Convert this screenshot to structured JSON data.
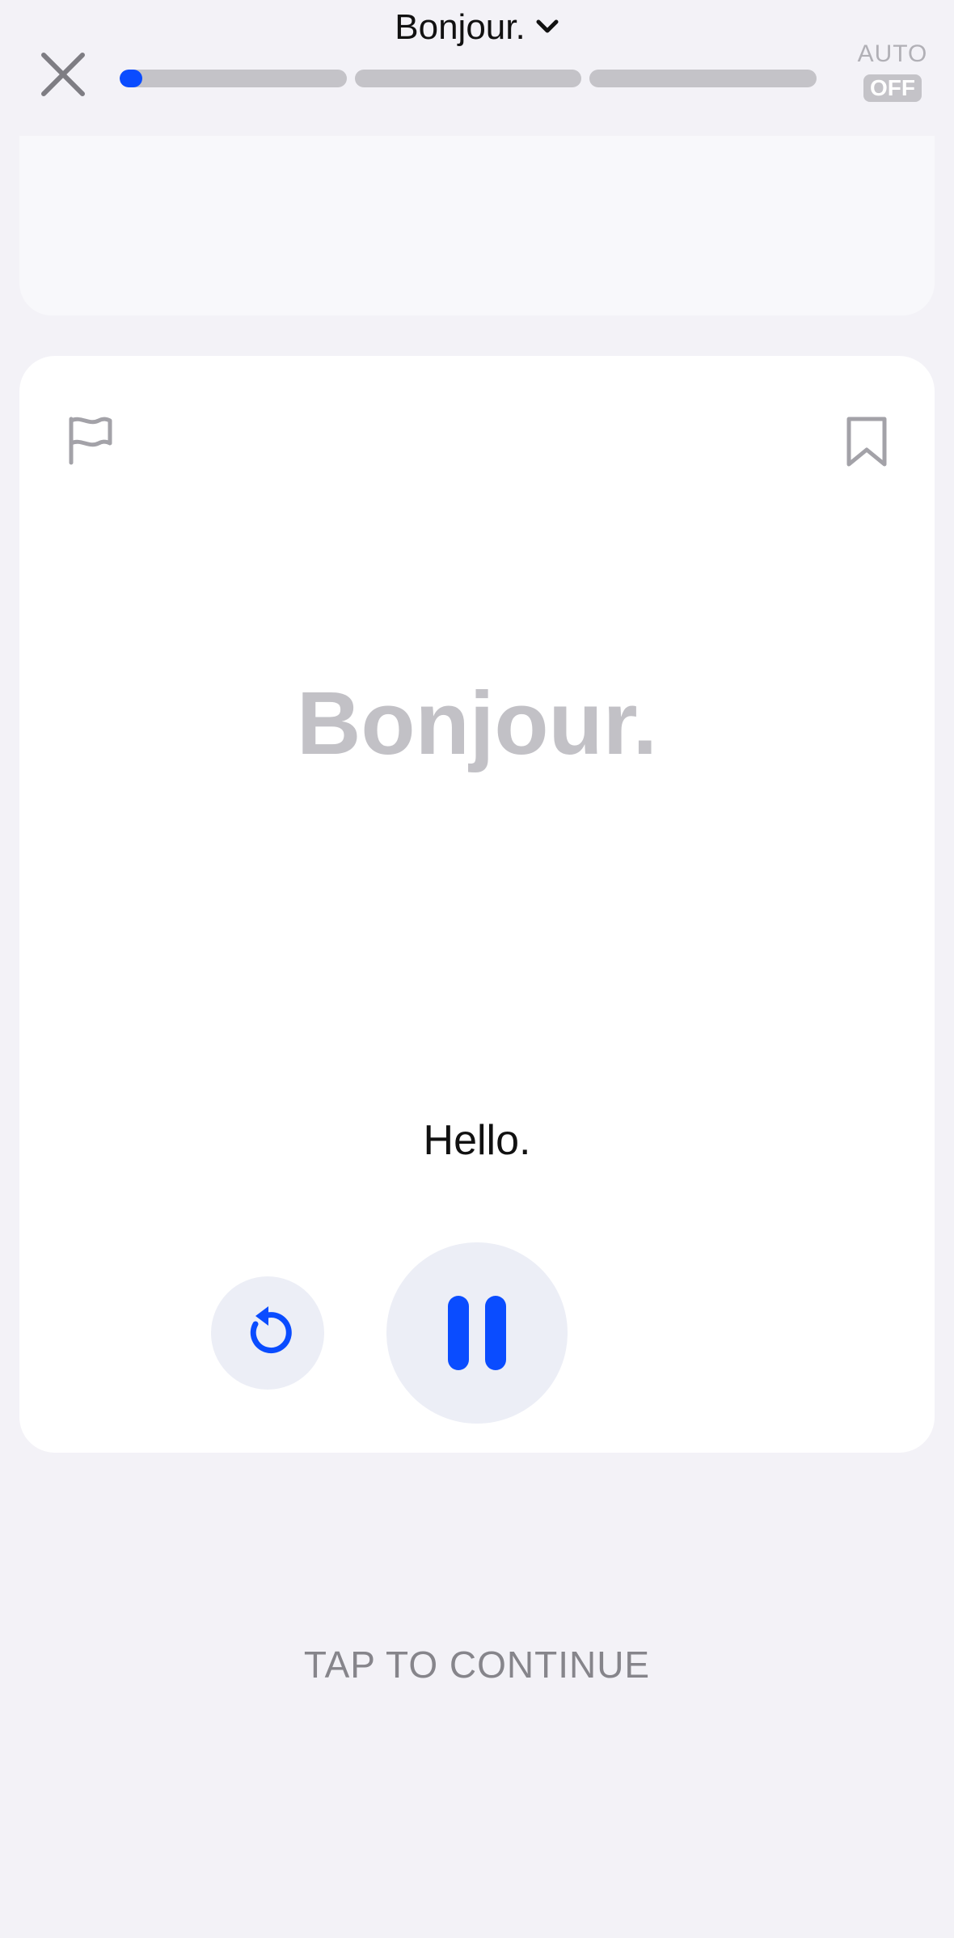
{
  "header": {
    "title": "Bonjour.",
    "title_dropdown_icon": "chevron-down-icon",
    "close_icon": "close-icon",
    "auto_label": "AUTO",
    "auto_state": "OFF"
  },
  "progress": {
    "segments": 3,
    "current_segment_progress": 0.1
  },
  "card": {
    "flag_icon": "flag-icon",
    "bookmark_icon": "bookmark-icon",
    "phrase": "Bonjour.",
    "translation": "Hello.",
    "replay_icon": "replay-icon",
    "pause_icon": "pause-icon"
  },
  "footer": {
    "continue_label": "TAP TO CONTINUE"
  },
  "colors": {
    "accent": "#0a4cff",
    "background": "#f3f2f7",
    "muted": "#c4c3c8"
  }
}
